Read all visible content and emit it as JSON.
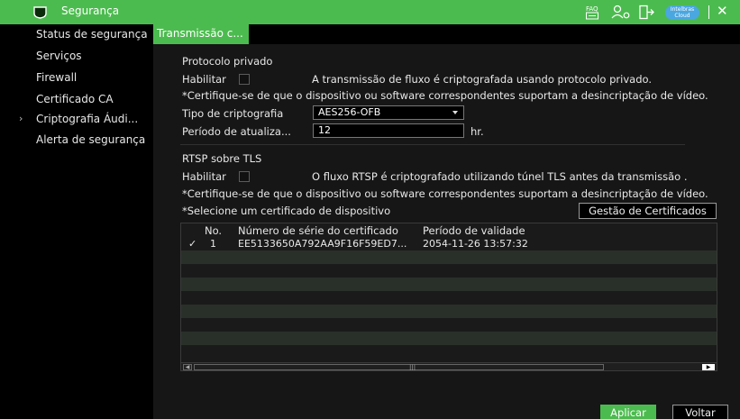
{
  "header": {
    "title": "Segurança",
    "cloud_badge": [
      "Intelbras",
      "Cloud"
    ],
    "accent_color": "#4cbb4f"
  },
  "sidebar": {
    "items": [
      {
        "label": "Status de segurança"
      },
      {
        "label": "Serviços"
      },
      {
        "label": "Firewall"
      },
      {
        "label": "Certificado CA"
      },
      {
        "label": "Criptografia Áudi...",
        "selected": true
      },
      {
        "label": "Alerta de segurança"
      }
    ]
  },
  "tab": {
    "label": "Transmissão c..."
  },
  "private_protocol": {
    "section_title": "Protocolo privado",
    "enable_label": "Habilitar",
    "enabled": false,
    "description": "A transmissão de fluxo é criptografada usando protocolo privado.",
    "note": "*Certifique-se de que o dispositivo ou software correspondentes suportam a desincriptação de vídeo.",
    "encryption_type_label": "Tipo de criptografia",
    "encryption_type_value": "AES256-OFB",
    "update_period_label": "Período de atualiza...",
    "update_period_value": "12",
    "update_period_unit": "hr."
  },
  "rtsp": {
    "section_title": "RTSP sobre TLS",
    "enable_label": "Habilitar",
    "enabled": false,
    "description": "O fluxo RTSP é criptografado utilizando túnel TLS antes da transmissão .",
    "note": "*Certifique-se de que o dispositivo ou software correspondentes suportam a desincriptação de vídeo.",
    "select_cert_label": "*Selecione um certificado de dispositivo",
    "cert_mgmt_button": "Gestão de Certificados"
  },
  "table": {
    "columns": [
      "No.",
      "Número de série do certificado",
      "Período de validade"
    ],
    "rows": [
      {
        "check": "✓",
        "no": "1",
        "serial": "EE5133650A792AA9F16F59ED7...",
        "validity": "2054-11-26 13:57:32"
      }
    ]
  },
  "footer": {
    "apply_label": "Aplicar",
    "back_label": "Voltar"
  }
}
